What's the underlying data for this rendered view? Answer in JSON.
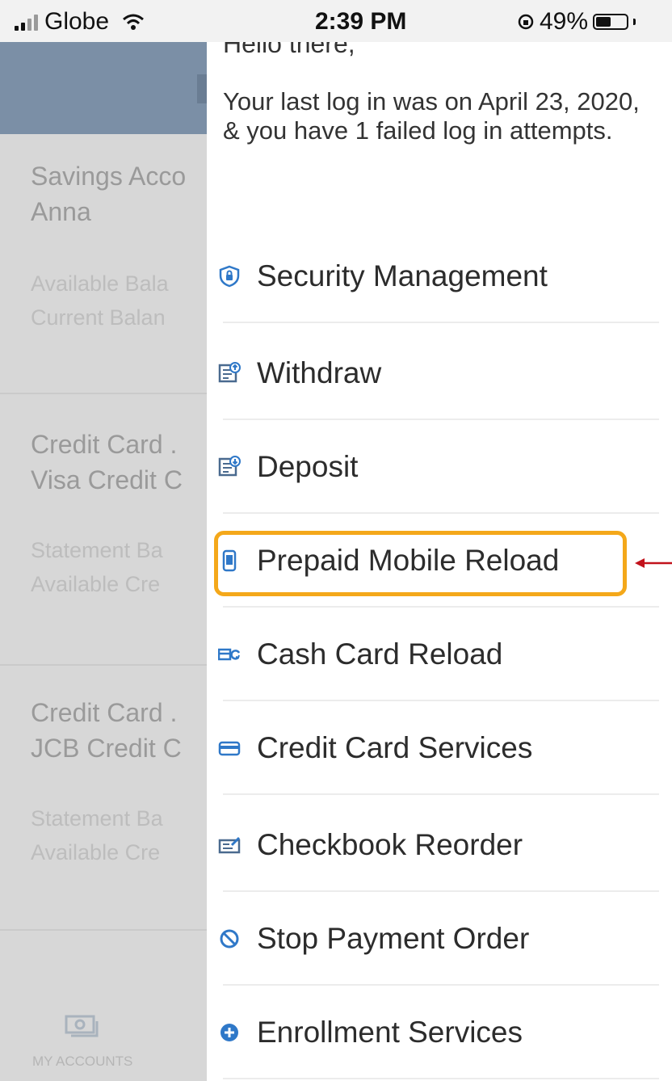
{
  "status_bar": {
    "carrier": "Globe",
    "time": "2:39 PM",
    "battery": "49%"
  },
  "background_screen": {
    "account_1": {
      "title": "Savings Acco",
      "name": "Anna",
      "line_1": "Available Bala",
      "line_2": "Current Balan"
    },
    "account_2": {
      "title": "Credit Card .",
      "name": "Visa Credit C",
      "line_1": "Statement Ba",
      "line_2": "Available Cre"
    },
    "account_3": {
      "title": "Credit Card .",
      "name": "JCB Credit C",
      "line_1": "Statement Ba",
      "line_2": "Available Cre"
    },
    "bottom_nav_label": "MY ACCOUNTS"
  },
  "drawer": {
    "greeting": "Hello there,",
    "last_login": "Your last log in was on April 23, 2020, & you have 1 failed log in attempts.",
    "menu": [
      {
        "label": "Security Management",
        "icon": "shield-lock-icon"
      },
      {
        "label": "Withdraw",
        "icon": "withdraw-icon"
      },
      {
        "label": "Deposit",
        "icon": "deposit-icon"
      },
      {
        "label": "Prepaid Mobile Reload",
        "icon": "mobile-phone-icon"
      },
      {
        "label": "Cash Card Reload",
        "icon": "cash-card-reload-icon"
      },
      {
        "label": "Credit Card Services",
        "icon": "credit-card-icon"
      },
      {
        "label": "Checkbook Reorder",
        "icon": "checkbook-icon"
      },
      {
        "label": "Stop Payment Order",
        "icon": "stop-icon"
      },
      {
        "label": "Enrollment Services",
        "icon": "plus-circle-icon"
      }
    ]
  },
  "colors": {
    "accent_blue": "#2f78c8",
    "highlight_border": "#f4a81a",
    "annotation_arrow": "#c2121b",
    "background_header": "#7b8fa6"
  }
}
